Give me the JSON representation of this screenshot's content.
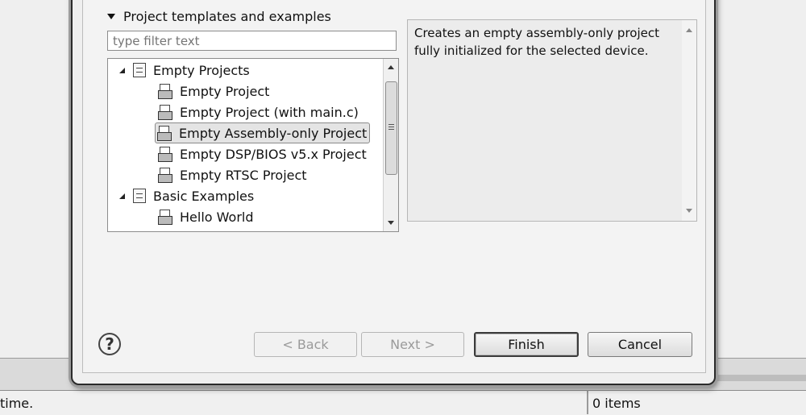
{
  "section": {
    "title": "Project templates and examples"
  },
  "filter": {
    "placeholder": "type filter text"
  },
  "tree": {
    "groups": [
      {
        "label": "Empty Projects",
        "items": [
          "Empty Project",
          "Empty Project (with main.c)",
          "Empty Assembly-only Project",
          "Empty DSP/BIOS v5.x Project",
          "Empty RTSC Project"
        ]
      },
      {
        "label": "Basic Examples",
        "items": [
          "Hello World"
        ]
      }
    ],
    "selected": "Empty Assembly-only Project"
  },
  "description": {
    "text": "Creates an empty assembly-only project fully initialized for the selected device."
  },
  "buttons": {
    "back": "< Back",
    "next": "Next >",
    "finish": "Finish",
    "cancel": "Cancel",
    "help": "?"
  },
  "statusbar": {
    "left": "time.",
    "right": "0 items"
  }
}
